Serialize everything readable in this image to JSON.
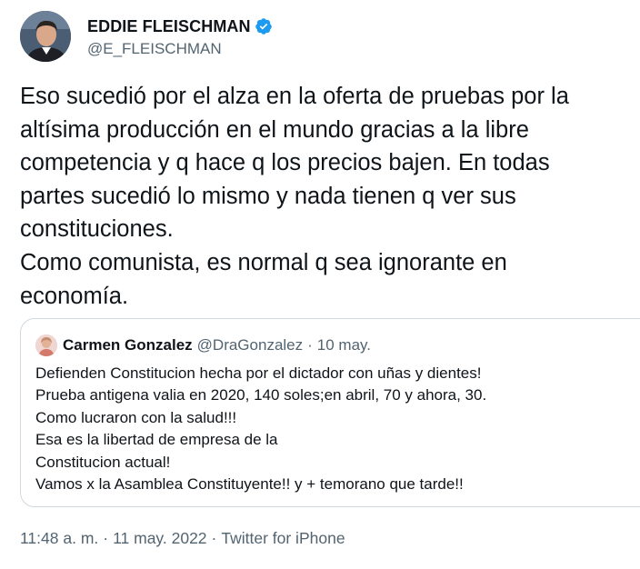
{
  "author": {
    "display_name": "EDDIE FLEISCHMAN",
    "handle": "@E_FLEISCHMAN",
    "verified": true,
    "avatar_icon": "profile-photo-icon"
  },
  "tweet": {
    "text": "Eso sucedió por el alza en la oferta de pruebas por la\naltísima producción en el mundo gracias a la libre\ncompetencia y q hace q los precios bajen. En todas\npartes sucedió lo mismo y nada tienen q ver sus\nconstituciones.\nComo comunista, es normal q sea ignorante en\neconomía."
  },
  "quoted_tweet": {
    "display_name": "Carmen Gonzalez",
    "handle": "@DraGonzalez",
    "separator": "·",
    "date": "10 may.",
    "text": "Defienden Constitucion hecha por el dictador con uñas y dientes!\nPrueba antigena valia en 2020, 140 soles;en abril, 70 y ahora, 30.\nComo lucraron con la salud!!!\nEsa es la libertad de empresa de la\nConstitucion actual!\nVamos x la Asamblea Constituyente!! y + temorano que tarde!!"
  },
  "meta": {
    "time": "11:48 a. m.",
    "separator1": "·",
    "date": "11 may. 2022",
    "separator2": "·",
    "source": "Twitter for iPhone"
  },
  "colors": {
    "text_primary": "#0f1419",
    "text_secondary": "#536471",
    "verified_blue": "#1d9bf0",
    "border": "#cfd9de"
  }
}
